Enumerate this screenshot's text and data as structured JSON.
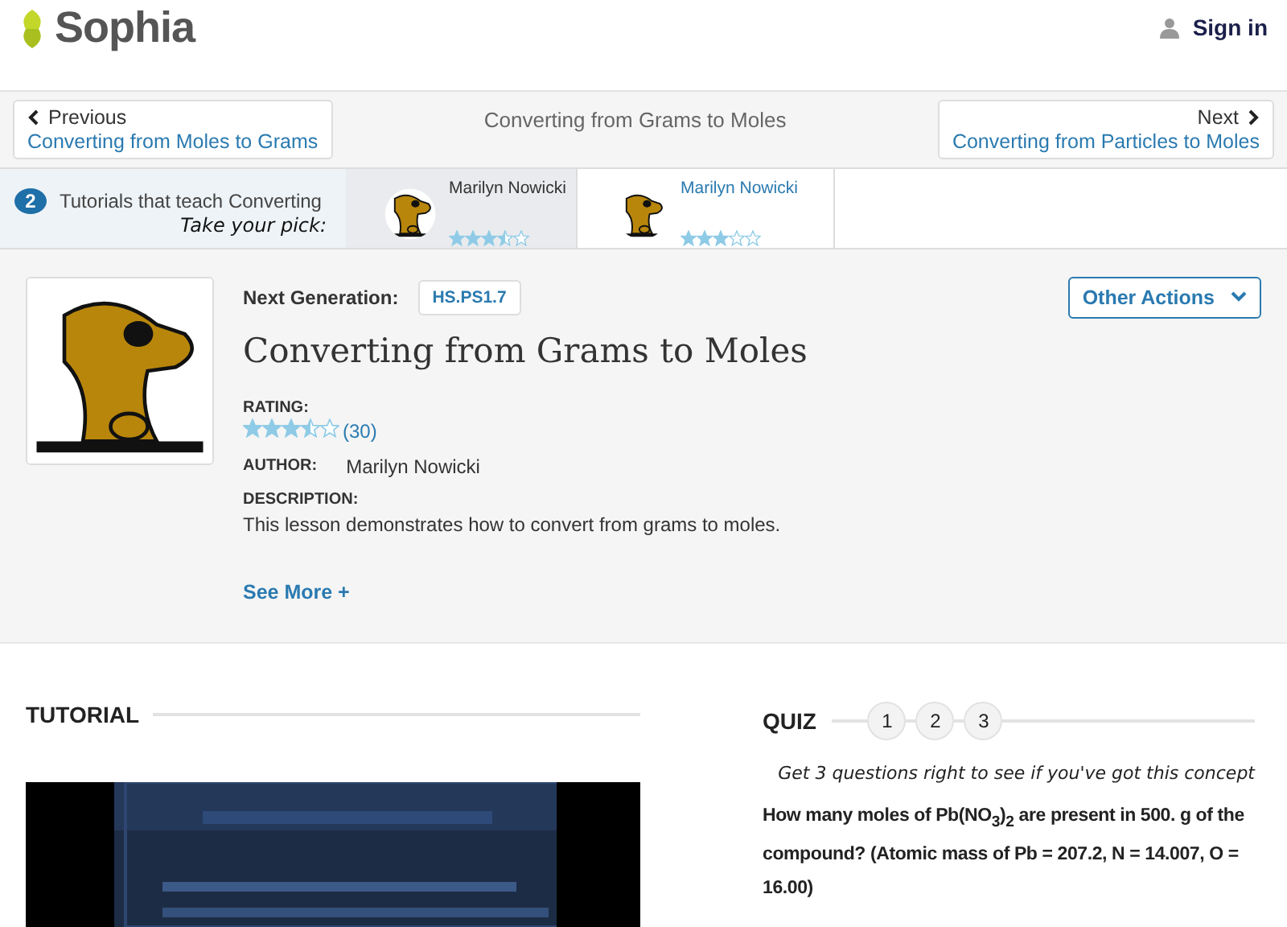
{
  "header": {
    "logo": "Sophia",
    "sign_in": "Sign in"
  },
  "nav": {
    "previous": {
      "label": "Previous",
      "link": "Converting from Moles to Grams"
    },
    "title": "Converting from Grams to Moles",
    "next": {
      "label": "Next",
      "link": "Converting from Particles to Moles"
    }
  },
  "tutorials_strip": {
    "count": "2",
    "text": "Tutorials that teach Converting",
    "tagline": "Take your pick:",
    "picks": [
      {
        "author": "Marilyn Nowicki",
        "stars": 3.5,
        "selected": true
      },
      {
        "author": "Marilyn Nowicki",
        "stars": 3,
        "selected": false
      }
    ]
  },
  "lesson": {
    "standard_label": "Next Generation:",
    "standard": "HS.PS1.7",
    "other_actions": "Other Actions",
    "title": "Converting from Grams to Moles",
    "rating_label": "RATING:",
    "stars": 3.5,
    "rating_count": "(30)",
    "author_label": "AUTHOR:",
    "author": "Marilyn Nowicki",
    "description_label": "DESCRIPTION:",
    "description": "This lesson demonstrates how to convert from grams to moles.",
    "see_more": "See More +"
  },
  "tutorial": {
    "heading": "TUTORIAL"
  },
  "quiz": {
    "heading": "QUIZ",
    "steps": [
      "1",
      "2",
      "3"
    ],
    "tagline": "Get 3 questions right to see if you've got this concept",
    "question": "How many moles of Pb(NO$_{3}$)$_{2}$ are present in 500. g of the compound? (Atomic mass of Pb = 207.2, N = 14.007, O = 16.00)"
  }
}
